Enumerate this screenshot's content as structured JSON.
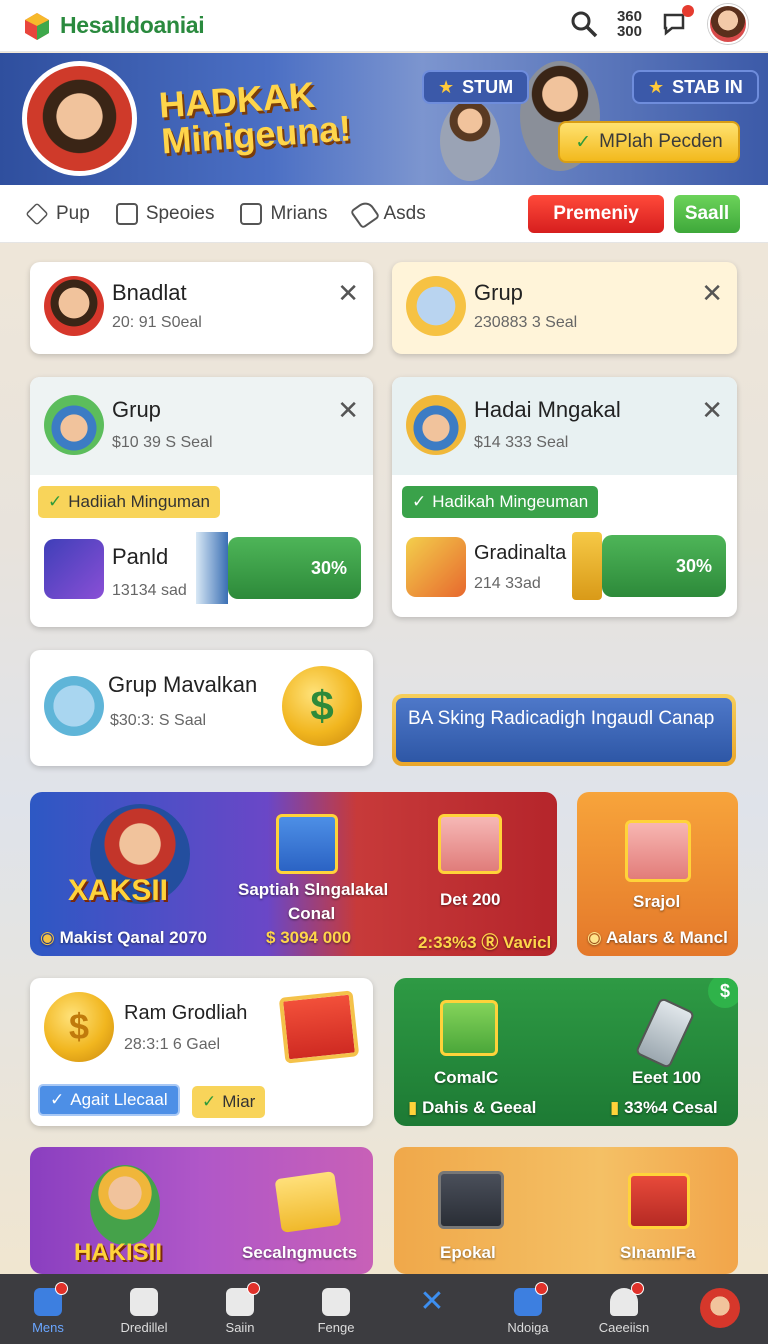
{
  "header": {
    "brand": "HesalIdoaniai",
    "counter_top": "360",
    "counter_bottom": "300"
  },
  "hero": {
    "title_line1": "HADKAK",
    "title_line2": "Minigeuna!",
    "pill_left": "STUM",
    "pill_right": "STAB IN",
    "cta": "MPlah Pecden"
  },
  "nav": {
    "items": [
      {
        "label": "Pup",
        "icon": "diamond-icon"
      },
      {
        "label": "Speoies",
        "icon": "book-icon"
      },
      {
        "label": "Mrians",
        "icon": "list-icon"
      },
      {
        "label": "Asds",
        "icon": "tag-icon"
      }
    ],
    "primary_button": "Premeniy",
    "secondary_button": "Saall"
  },
  "cards": {
    "bnadlat": {
      "title": "Bnadlat",
      "sub": "20: 91 S0eal"
    },
    "grup_top": {
      "title": "Grup",
      "sub": "230883 3 Seal"
    },
    "grup_mid": {
      "title": "Grup",
      "sub": "$10 39 S Seal",
      "tag": "Hadiiah Minguman",
      "item_title": "Panld",
      "item_sub": "13134 sad",
      "progress": "30%"
    },
    "hadai": {
      "title": "Hadai Mngakal",
      "sub": "$14 333 Seal",
      "tag": "Hadikah Mingeuman",
      "item_title": "Gradinalta",
      "item_sub": "214 33ad",
      "progress": "30%"
    },
    "grup_mav": {
      "title": "Grup Mavalkan",
      "sub": "$30:3: S Saal"
    },
    "blue_banner": "BA Sking Radicadigh Ingaudl Canap",
    "ram": {
      "title": "Ram Grodliah",
      "sub": "28:3:1 6 Gael",
      "tag1": "Agait Llecaal",
      "tag2": "Miar"
    }
  },
  "promos": {
    "xaksii": {
      "title": "XAKSII",
      "footer": "Makist Qanal 2070"
    },
    "sapthah": {
      "title": "Saptiah Slngalakal",
      "sub": "Conal",
      "amount": "3094 000"
    },
    "det": {
      "title": "Det 200",
      "footer": "2:33%3 Ⓡ Vavicl"
    },
    "srajol": {
      "title": "Srajol",
      "footer": "Aalars & Mancl"
    },
    "comalc": {
      "title": "ComalC",
      "footer": "Dahis & Geeal"
    },
    "eet": {
      "title": "Eeet 100",
      "footer": "33%4 Cesal"
    },
    "hakisii": {
      "title": "HAKISII"
    },
    "secal": {
      "title": "Secalngmucts"
    },
    "epokal": {
      "title": "Epokal"
    },
    "sinam": {
      "title": "SInamIFa"
    }
  },
  "bottom_nav": [
    {
      "label": "Mens",
      "icon": "home-icon",
      "active": true
    },
    {
      "label": "Dredillel",
      "icon": "dice-icon"
    },
    {
      "label": "Saiin",
      "icon": "chat-icon"
    },
    {
      "label": "Fenge",
      "icon": "grid-icon"
    },
    {
      "label": "",
      "icon": "close-icon"
    },
    {
      "label": "Ndoiga",
      "icon": "camera-icon"
    },
    {
      "label": "Caeeiisn",
      "icon": "person-icon"
    }
  ]
}
